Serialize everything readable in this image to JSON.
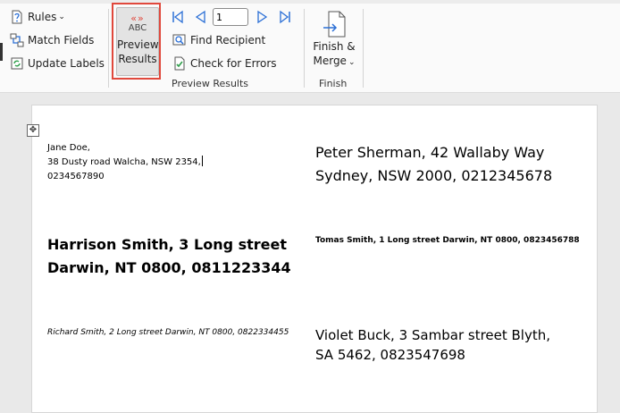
{
  "ribbon": {
    "write_group": {
      "rules_label": "Rules",
      "match_fields_label": "Match Fields",
      "update_labels_label": "Update Labels"
    },
    "preview_group": {
      "preview_button": {
        "top": "ABC",
        "line1": "Preview",
        "line2": "Results"
      },
      "record_number": "1",
      "find_recipient_label": "Find Recipient",
      "check_errors_label": "Check for Errors",
      "group_label": "Preview Results"
    },
    "finish_group": {
      "finish_button": {
        "line1": "Finish &",
        "line2": "Merge"
      },
      "group_label": "Finish"
    }
  },
  "document": {
    "labels": [
      {
        "lines": [
          "Jane Doe,",
          "38 Dusty road Walcha, NSW 2354,",
          "0234567890"
        ]
      },
      {
        "lines": [
          "Peter Sherman, 42 Wallaby Way",
          "Sydney, NSW 2000, 0212345678"
        ]
      },
      {
        "lines": [
          "Harrison Smith, 3 Long street",
          "Darwin, NT 0800, 0811223344"
        ]
      },
      {
        "lines": [
          "Tomas Smith, 1 Long street Darwin, NT 0800, 0823456788"
        ]
      },
      {
        "lines": [
          "Richard Smith, 2 Long street Darwin, NT 0800, 0822334455"
        ]
      },
      {
        "lines": [
          "Violet Buck, 3 Sambar street Blyth,",
          "SA 5462, 0823547698"
        ]
      }
    ]
  },
  "colors": {
    "accent_blue": "#2b6fd6",
    "highlight_red": "#e0483c",
    "ribbon_bg": "#fafafa",
    "canvas_bg": "#e9e9e9"
  },
  "icons": [
    "rules-icon",
    "match-fields-icon",
    "update-labels-icon",
    "first-record-icon",
    "previous-record-icon",
    "next-record-icon",
    "last-record-icon",
    "find-recipient-icon",
    "check-errors-icon",
    "finish-merge-icon",
    "move-handle-icon"
  ]
}
